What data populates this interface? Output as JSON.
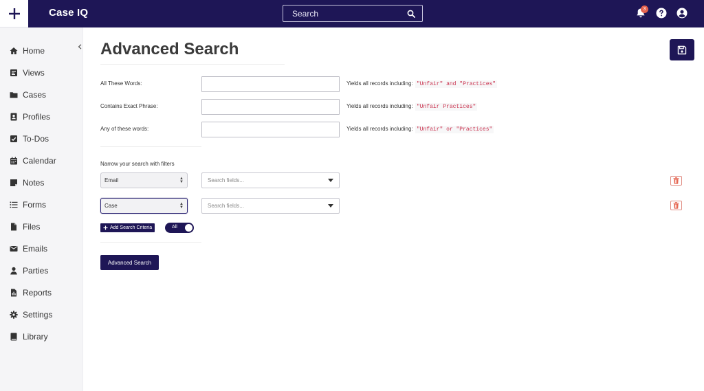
{
  "app": {
    "brand": "Case IQ"
  },
  "topbar": {
    "search_placeholder": "Search",
    "notification_count": "3",
    "icons": {
      "add": "plus-icon",
      "search": "search-icon",
      "notifications": "bell-icon",
      "help": "help-icon",
      "account": "user-circle-icon"
    }
  },
  "sidebar": {
    "items": [
      {
        "label": "Home",
        "icon": "home-icon"
      },
      {
        "label": "Views",
        "icon": "views-icon"
      },
      {
        "label": "Cases",
        "icon": "folder-icon"
      },
      {
        "label": "Profiles",
        "icon": "profile-icon"
      },
      {
        "label": "To-Dos",
        "icon": "checkbox-icon"
      },
      {
        "label": "Calendar",
        "icon": "calendar-icon"
      },
      {
        "label": "Notes",
        "icon": "note-icon"
      },
      {
        "label": "Forms",
        "icon": "list-icon"
      },
      {
        "label": "Files",
        "icon": "file-icon"
      },
      {
        "label": "Emails",
        "icon": "envelope-icon"
      },
      {
        "label": "Parties",
        "icon": "person-icon"
      },
      {
        "label": "Reports",
        "icon": "report-icon"
      },
      {
        "label": "Settings",
        "icon": "gear-icon"
      },
      {
        "label": "Library",
        "icon": "book-icon"
      }
    ]
  },
  "main": {
    "title": "Advanced Search",
    "rows": [
      {
        "label": "All These Words:",
        "value": "",
        "hint": "Yields all records including:",
        "example": "\"Unfair\" and \"Practices\""
      },
      {
        "label": "Contains Exact Phrase:",
        "value": "",
        "hint": "Yields all records including:",
        "example": "\"Unfair Practices\""
      },
      {
        "label": "Any of these words:",
        "value": "",
        "hint": "Yields all records including:",
        "example": "\"Unfair\" or \"Practices\""
      }
    ],
    "narrow_label": "Narrow your search with filters",
    "filters": [
      {
        "type": "Email",
        "field_placeholder": "Search fields..."
      },
      {
        "type": "Case",
        "field_placeholder": "Search fields..."
      }
    ],
    "add_criteria_label": "Add Search Criteria",
    "toggle_label": "All",
    "advanced_search_label": "Advanced Search"
  },
  "colors": {
    "navy": "#1e1656",
    "code_red": "#c9304c",
    "trash_red": "#e5624d",
    "badge": "#e5624d"
  }
}
